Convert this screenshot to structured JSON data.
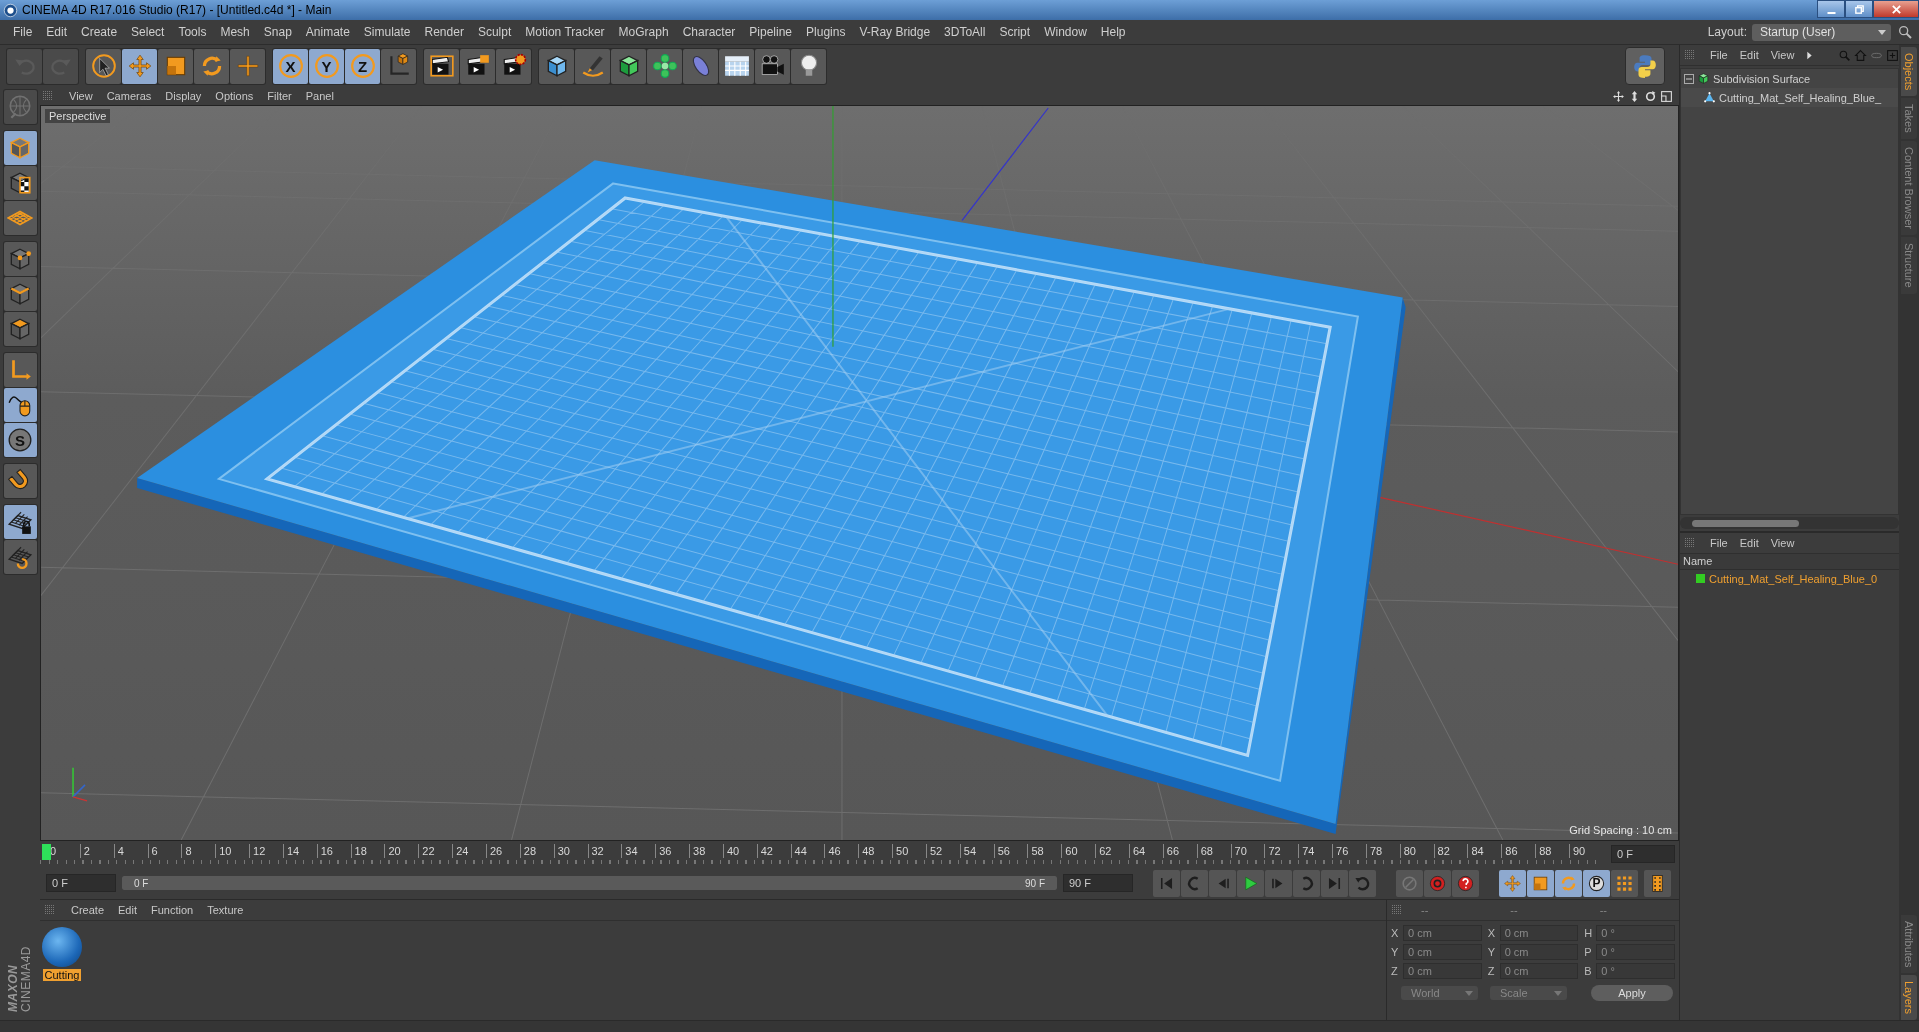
{
  "window": {
    "title": "CINEMA 4D R17.016 Studio (R17) - [Untitled.c4d *] - Main"
  },
  "menu_bar": [
    "File",
    "Edit",
    "Create",
    "Select",
    "Tools",
    "Mesh",
    "Snap",
    "Animate",
    "Simulate",
    "Render",
    "Sculpt",
    "Motion Tracker",
    "MoGraph",
    "Character",
    "Pipeline",
    "Plugins",
    "V-Ray Bridge",
    "3DToAll",
    "Script",
    "Window",
    "Help"
  ],
  "layout": {
    "label": "Layout:",
    "value": "Startup (User)"
  },
  "toolbar": [
    [
      {
        "kind": "undo",
        "selected": false,
        "disabled": true
      },
      {
        "kind": "redo",
        "selected": false,
        "disabled": true
      }
    ],
    [
      {
        "kind": "select",
        "selected": false,
        "disabled": false
      },
      {
        "kind": "move",
        "selected": true,
        "disabled": false
      },
      {
        "kind": "scale",
        "selected": false,
        "disabled": false
      },
      {
        "kind": "rotate",
        "selected": false,
        "disabled": false
      },
      {
        "kind": "place",
        "selected": false,
        "disabled": false
      }
    ],
    [
      {
        "kind": "axis",
        "label": "X",
        "selected": true,
        "disabled": false
      },
      {
        "kind": "axis",
        "label": "Y",
        "selected": true,
        "disabled": false
      },
      {
        "kind": "axis",
        "label": "Z",
        "selected": true,
        "disabled": false
      },
      {
        "kind": "coords",
        "selected": false,
        "disabled": false
      }
    ],
    [
      {
        "kind": "render-view",
        "selected": false,
        "disabled": false
      },
      {
        "kind": "render",
        "selected": false,
        "disabled": false
      },
      {
        "kind": "render-settings",
        "selected": false,
        "disabled": false
      }
    ],
    [
      {
        "kind": "cube",
        "selected": false,
        "disabled": false
      },
      {
        "kind": "pen",
        "selected": false,
        "disabled": false
      },
      {
        "kind": "subdivision",
        "selected": false,
        "disabled": false
      },
      {
        "kind": "cloner",
        "selected": false,
        "disabled": false
      },
      {
        "kind": "deformer",
        "selected": false,
        "disabled": false
      },
      {
        "kind": "floor",
        "selected": false,
        "disabled": false
      },
      {
        "kind": "camera",
        "selected": false,
        "disabled": false
      },
      {
        "kind": "light",
        "selected": false,
        "disabled": false
      }
    ]
  ],
  "left_toolbar": [
    [
      {
        "kind": "globe",
        "selected": false,
        "disabled": true
      }
    ],
    [
      {
        "kind": "model",
        "selected": true,
        "disabled": false
      },
      {
        "kind": "texture",
        "selected": false,
        "disabled": false
      },
      {
        "kind": "workplane",
        "selected": false,
        "disabled": false
      }
    ],
    [
      {
        "kind": "points",
        "selected": false,
        "disabled": false
      },
      {
        "kind": "edges",
        "selected": false,
        "disabled": false
      },
      {
        "kind": "polygons",
        "selected": false,
        "disabled": false
      }
    ],
    [
      {
        "kind": "axis-l",
        "selected": false,
        "disabled": false
      },
      {
        "kind": "tweak",
        "selected": true,
        "disabled": false
      },
      {
        "kind": "snap",
        "label": "S",
        "selected": true,
        "disabled": false
      }
    ],
    [
      {
        "kind": "magnet",
        "selected": false,
        "disabled": false
      }
    ],
    [
      {
        "kind": "lock-grid",
        "selected": true,
        "disabled": false
      },
      {
        "kind": "grid-refresh",
        "selected": false,
        "disabled": false
      }
    ]
  ],
  "logo": [
    "MAXON",
    "CINEMA4D"
  ],
  "viewport": {
    "menu": [
      "View",
      "Cameras",
      "Display",
      "Options",
      "Filter",
      "Panel"
    ],
    "camera": "Perspective",
    "grid_spacing": "Grid Spacing : 10 cm"
  },
  "timeline": {
    "ticks": [
      "0",
      "2",
      "4",
      "6",
      "8",
      "10",
      "12",
      "14",
      "16",
      "18",
      "20",
      "22",
      "24",
      "26",
      "28",
      "30",
      "32",
      "34",
      "36",
      "38",
      "40",
      "42",
      "44",
      "46",
      "48",
      "50",
      "52",
      "54",
      "56",
      "58",
      "60",
      "62",
      "64",
      "66",
      "68",
      "70",
      "72",
      "74",
      "76",
      "78",
      "80",
      "82",
      "84",
      "86",
      "88",
      "90"
    ],
    "playhead": {
      "level": 0
    },
    "current_frame": "0 F",
    "start_field": "0 F",
    "range_slider": {
      "start": "0 F",
      "end": "90 F",
      "level": 1
    },
    "end_field": "90 F",
    "transport": [
      {
        "kind": "go-start"
      },
      {
        "kind": "prev-key"
      },
      {
        "kind": "prev-frame"
      },
      {
        "kind": "play"
      },
      {
        "kind": "next-frame"
      },
      {
        "kind": "next-key"
      },
      {
        "kind": "go-end"
      },
      {
        "kind": "loop"
      }
    ],
    "record": [
      {
        "kind": "record-keys"
      },
      {
        "kind": "record"
      },
      {
        "kind": "autokey"
      }
    ],
    "key_modes": [
      {
        "kind": "move",
        "selected": true
      },
      {
        "kind": "scale",
        "selected": true
      },
      {
        "kind": "rotate",
        "selected": true
      },
      {
        "kind": "param",
        "label": "P",
        "selected": true
      },
      {
        "kind": "points-grid",
        "selected": false
      }
    ]
  },
  "material_manager": {
    "menu": [
      "Create",
      "Edit",
      "Function",
      "Texture"
    ],
    "materials": [
      {
        "name": "Cutting",
        "selected": true
      }
    ]
  },
  "coordinates": {
    "headers": [
      "--",
      "--",
      "--"
    ],
    "columns": [
      [
        {
          "axis": "X",
          "value": "0 cm"
        },
        {
          "axis": "Y",
          "value": "0 cm"
        },
        {
          "axis": "Z",
          "value": "0 cm"
        }
      ],
      [
        {
          "axis": "X",
          "value": "0 cm"
        },
        {
          "axis": "Y",
          "value": "0 cm"
        },
        {
          "axis": "Z",
          "value": "0 cm"
        }
      ],
      [
        {
          "axis": "H",
          "value": "0 °"
        },
        {
          "axis": "P",
          "value": "0 °"
        },
        {
          "axis": "B",
          "value": "0 °"
        }
      ]
    ],
    "dropdowns": [
      "World",
      "Scale"
    ],
    "apply": "Apply"
  },
  "objects": {
    "menu": [
      "File",
      "Edit",
      "View"
    ],
    "tree": [
      {
        "name": "Subdivision Surface",
        "kind": "subdivision",
        "expanded": true,
        "children": [
          {
            "name": "Cutting_Mat_Self_Healing_Blue_",
            "kind": "polygon"
          }
        ]
      }
    ]
  },
  "side_tabs": [
    {
      "label": "Objects",
      "selected": true
    },
    {
      "label": "Takes",
      "selected": false
    },
    {
      "label": "Content Browser",
      "selected": false
    },
    {
      "label": "Structure",
      "selected": false
    }
  ],
  "layers": {
    "menu": [
      "File",
      "Edit",
      "View"
    ],
    "column": "Name",
    "rows": [
      {
        "name": "Cutting_Mat_Self_Healing_Blue_0",
        "color": "#33cc22"
      }
    ]
  },
  "lower_tabs": [
    {
      "label": "Attributes",
      "selected": false
    },
    {
      "label": "Layers",
      "selected": true
    }
  ]
}
